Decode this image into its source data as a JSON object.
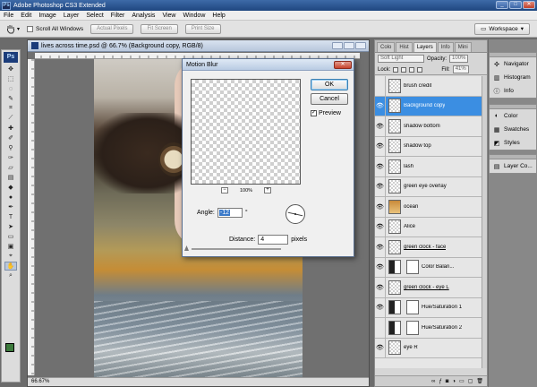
{
  "app": {
    "title": "Adobe Photoshop CS3 Extended",
    "icon": "ps-app-icon",
    "logo_text": "Ps"
  },
  "window_buttons": {
    "minimize": "_",
    "maximize": "□",
    "close": "✕"
  },
  "menu": [
    "File",
    "Edit",
    "Image",
    "Layer",
    "Select",
    "Filter",
    "Analysis",
    "View",
    "Window",
    "Help"
  ],
  "options_bar": {
    "scroll_all_windows": "Scroll All Windows",
    "actual_pixels": "Actual Pixels",
    "fit_screen": "Fit Screen",
    "print_size": "Print Size",
    "workspace": "Workspace"
  },
  "document": {
    "title": "lives across time.psd @ 66.7% (Background copy, RGB/8)",
    "status": "66.67%"
  },
  "dialog": {
    "title": "Motion Blur",
    "ok": "OK",
    "cancel": "Cancel",
    "preview_label": "Preview",
    "preview_checked": "✓",
    "zoom": "100%",
    "angle_label": "Angle:",
    "angle_value": "-12",
    "degree": "°",
    "distance_label": "Distance:",
    "distance_value": "4",
    "distance_unit": "pixels"
  },
  "layers_panel": {
    "tabs": [
      "Colo",
      "Hist",
      "Layers",
      "Info",
      "Mini"
    ],
    "blend_mode": "Soft Light",
    "opacity_label": "Opacity:",
    "opacity_value": "100%",
    "lock_label": "Lock:",
    "fill_label": "Fill:",
    "fill_value": "41%",
    "layers": [
      {
        "name": "brush credit",
        "visible": false,
        "thumb": "checker"
      },
      {
        "name": "Background copy",
        "visible": true,
        "thumb": "checker",
        "selected": true
      },
      {
        "name": "shadow bottom",
        "visible": true,
        "thumb": "checker"
      },
      {
        "name": "shadow top",
        "visible": true,
        "thumb": "checker"
      },
      {
        "name": "lash",
        "visible": true,
        "thumb": "checker"
      },
      {
        "name": "green eye overlay",
        "visible": true,
        "thumb": "checker"
      },
      {
        "name": "ocean",
        "visible": true,
        "thumb": "photo"
      },
      {
        "name": "Alice",
        "visible": true,
        "thumb": "checker"
      },
      {
        "name": "green clock - face",
        "visible": true,
        "thumb": "checker"
      },
      {
        "name": "Color Balan...",
        "visible": true,
        "thumb": "adj"
      },
      {
        "name": "green clock - eye L",
        "visible": true,
        "thumb": "checker"
      },
      {
        "name": "Hue/Saturation 1",
        "visible": true,
        "thumb": "adj"
      },
      {
        "name": "Hue/Saturation 2",
        "visible": false,
        "thumb": "adj"
      },
      {
        "name": "eye R",
        "visible": true,
        "thumb": "checker"
      }
    ],
    "eye_glyph": "👁"
  },
  "dock": {
    "group1": [
      {
        "label": "Navigator",
        "icon": "navigator-icon",
        "glyph": "✣"
      },
      {
        "label": "Histogram",
        "icon": "histogram-icon",
        "glyph": "▥"
      },
      {
        "label": "Info",
        "icon": "info-icon",
        "glyph": "ⓘ"
      }
    ],
    "group2": [
      {
        "label": "Color",
        "icon": "color-icon",
        "glyph": "◐"
      },
      {
        "label": "Swatches",
        "icon": "swatches-icon",
        "glyph": "▦"
      },
      {
        "label": "Styles",
        "icon": "styles-icon",
        "glyph": "◩"
      }
    ],
    "group3": [
      {
        "label": "Layer Co...",
        "icon": "layer-comps-icon",
        "glyph": "▤"
      }
    ]
  },
  "colors": {
    "foreground": "#3c7a3c",
    "background": "#ffffff",
    "selection": "#3b8ee2"
  }
}
